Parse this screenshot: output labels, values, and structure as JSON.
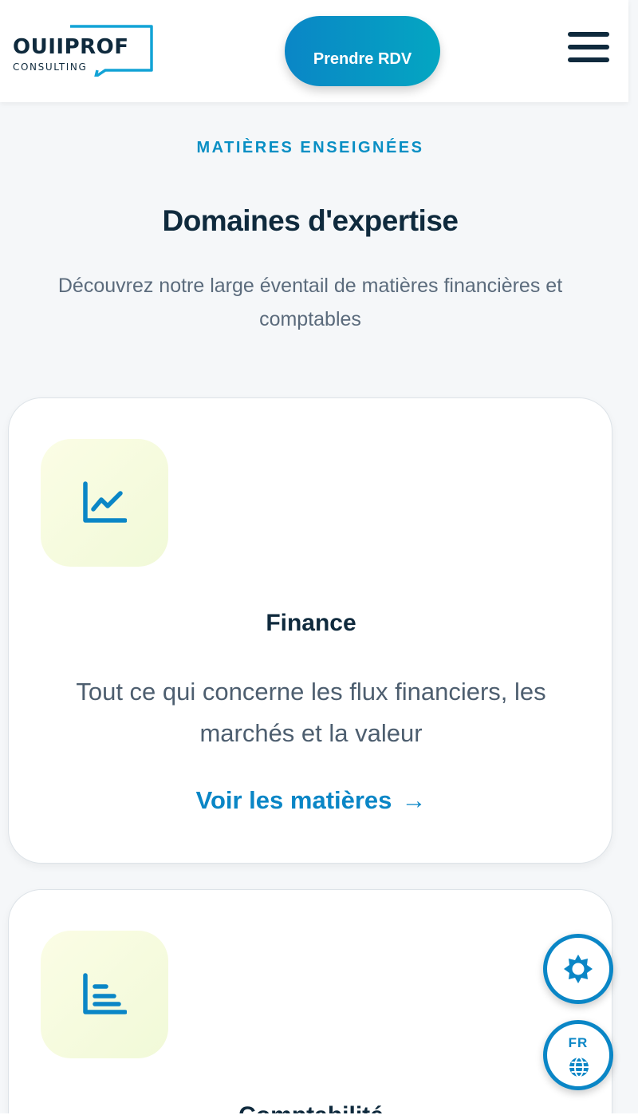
{
  "header": {
    "logo_main": "OUIIPROF",
    "logo_sub": "CONSULTING",
    "cta_label": "Prendre RDV"
  },
  "section": {
    "eyebrow": "MATIÈRES ENSEIGNÉES",
    "title": "Domaines d'expertise",
    "subtitle": "Découvrez notre large éventail de matières financières et comptables"
  },
  "cards": [
    {
      "icon": "line-chart-icon",
      "title": "Finance",
      "description": "Tout ce qui concerne les flux financiers, les marchés et la valeur",
      "link_label": "Voir les matières",
      "link_arrow": "→"
    },
    {
      "icon": "bar-list-icon",
      "title": "Comptabilité"
    }
  ],
  "floating": {
    "settings_icon": "gear-icon",
    "language_code": "FR",
    "language_icon": "globe-icon"
  },
  "colors": {
    "accent": "#0a86c6",
    "dark": "#0f2a3d",
    "icon_bg": "#f7fbe0"
  }
}
